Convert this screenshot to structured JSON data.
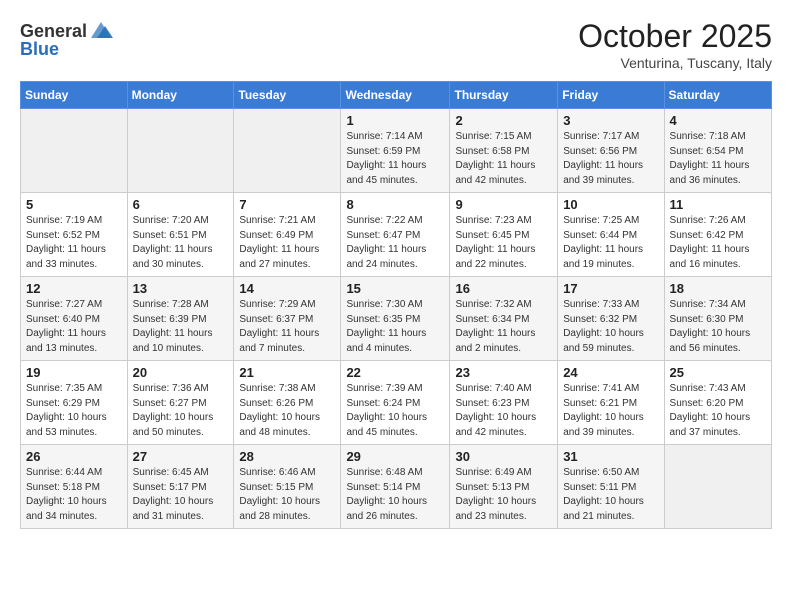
{
  "header": {
    "logo_general": "General",
    "logo_blue": "Blue",
    "title": "October 2025",
    "subtitle": "Venturina, Tuscany, Italy"
  },
  "weekdays": [
    "Sunday",
    "Monday",
    "Tuesday",
    "Wednesday",
    "Thursday",
    "Friday",
    "Saturday"
  ],
  "weeks": [
    [
      {
        "day": "",
        "info": ""
      },
      {
        "day": "",
        "info": ""
      },
      {
        "day": "",
        "info": ""
      },
      {
        "day": "1",
        "info": "Sunrise: 7:14 AM\nSunset: 6:59 PM\nDaylight: 11 hours and 45 minutes."
      },
      {
        "day": "2",
        "info": "Sunrise: 7:15 AM\nSunset: 6:58 PM\nDaylight: 11 hours and 42 minutes."
      },
      {
        "day": "3",
        "info": "Sunrise: 7:17 AM\nSunset: 6:56 PM\nDaylight: 11 hours and 39 minutes."
      },
      {
        "day": "4",
        "info": "Sunrise: 7:18 AM\nSunset: 6:54 PM\nDaylight: 11 hours and 36 minutes."
      }
    ],
    [
      {
        "day": "5",
        "info": "Sunrise: 7:19 AM\nSunset: 6:52 PM\nDaylight: 11 hours and 33 minutes."
      },
      {
        "day": "6",
        "info": "Sunrise: 7:20 AM\nSunset: 6:51 PM\nDaylight: 11 hours and 30 minutes."
      },
      {
        "day": "7",
        "info": "Sunrise: 7:21 AM\nSunset: 6:49 PM\nDaylight: 11 hours and 27 minutes."
      },
      {
        "day": "8",
        "info": "Sunrise: 7:22 AM\nSunset: 6:47 PM\nDaylight: 11 hours and 24 minutes."
      },
      {
        "day": "9",
        "info": "Sunrise: 7:23 AM\nSunset: 6:45 PM\nDaylight: 11 hours and 22 minutes."
      },
      {
        "day": "10",
        "info": "Sunrise: 7:25 AM\nSunset: 6:44 PM\nDaylight: 11 hours and 19 minutes."
      },
      {
        "day": "11",
        "info": "Sunrise: 7:26 AM\nSunset: 6:42 PM\nDaylight: 11 hours and 16 minutes."
      }
    ],
    [
      {
        "day": "12",
        "info": "Sunrise: 7:27 AM\nSunset: 6:40 PM\nDaylight: 11 hours and 13 minutes."
      },
      {
        "day": "13",
        "info": "Sunrise: 7:28 AM\nSunset: 6:39 PM\nDaylight: 11 hours and 10 minutes."
      },
      {
        "day": "14",
        "info": "Sunrise: 7:29 AM\nSunset: 6:37 PM\nDaylight: 11 hours and 7 minutes."
      },
      {
        "day": "15",
        "info": "Sunrise: 7:30 AM\nSunset: 6:35 PM\nDaylight: 11 hours and 4 minutes."
      },
      {
        "day": "16",
        "info": "Sunrise: 7:32 AM\nSunset: 6:34 PM\nDaylight: 11 hours and 2 minutes."
      },
      {
        "day": "17",
        "info": "Sunrise: 7:33 AM\nSunset: 6:32 PM\nDaylight: 10 hours and 59 minutes."
      },
      {
        "day": "18",
        "info": "Sunrise: 7:34 AM\nSunset: 6:30 PM\nDaylight: 10 hours and 56 minutes."
      }
    ],
    [
      {
        "day": "19",
        "info": "Sunrise: 7:35 AM\nSunset: 6:29 PM\nDaylight: 10 hours and 53 minutes."
      },
      {
        "day": "20",
        "info": "Sunrise: 7:36 AM\nSunset: 6:27 PM\nDaylight: 10 hours and 50 minutes."
      },
      {
        "day": "21",
        "info": "Sunrise: 7:38 AM\nSunset: 6:26 PM\nDaylight: 10 hours and 48 minutes."
      },
      {
        "day": "22",
        "info": "Sunrise: 7:39 AM\nSunset: 6:24 PM\nDaylight: 10 hours and 45 minutes."
      },
      {
        "day": "23",
        "info": "Sunrise: 7:40 AM\nSunset: 6:23 PM\nDaylight: 10 hours and 42 minutes."
      },
      {
        "day": "24",
        "info": "Sunrise: 7:41 AM\nSunset: 6:21 PM\nDaylight: 10 hours and 39 minutes."
      },
      {
        "day": "25",
        "info": "Sunrise: 7:43 AM\nSunset: 6:20 PM\nDaylight: 10 hours and 37 minutes."
      }
    ],
    [
      {
        "day": "26",
        "info": "Sunrise: 6:44 AM\nSunset: 5:18 PM\nDaylight: 10 hours and 34 minutes."
      },
      {
        "day": "27",
        "info": "Sunrise: 6:45 AM\nSunset: 5:17 PM\nDaylight: 10 hours and 31 minutes."
      },
      {
        "day": "28",
        "info": "Sunrise: 6:46 AM\nSunset: 5:15 PM\nDaylight: 10 hours and 28 minutes."
      },
      {
        "day": "29",
        "info": "Sunrise: 6:48 AM\nSunset: 5:14 PM\nDaylight: 10 hours and 26 minutes."
      },
      {
        "day": "30",
        "info": "Sunrise: 6:49 AM\nSunset: 5:13 PM\nDaylight: 10 hours and 23 minutes."
      },
      {
        "day": "31",
        "info": "Sunrise: 6:50 AM\nSunset: 5:11 PM\nDaylight: 10 hours and 21 minutes."
      },
      {
        "day": "",
        "info": ""
      }
    ]
  ]
}
